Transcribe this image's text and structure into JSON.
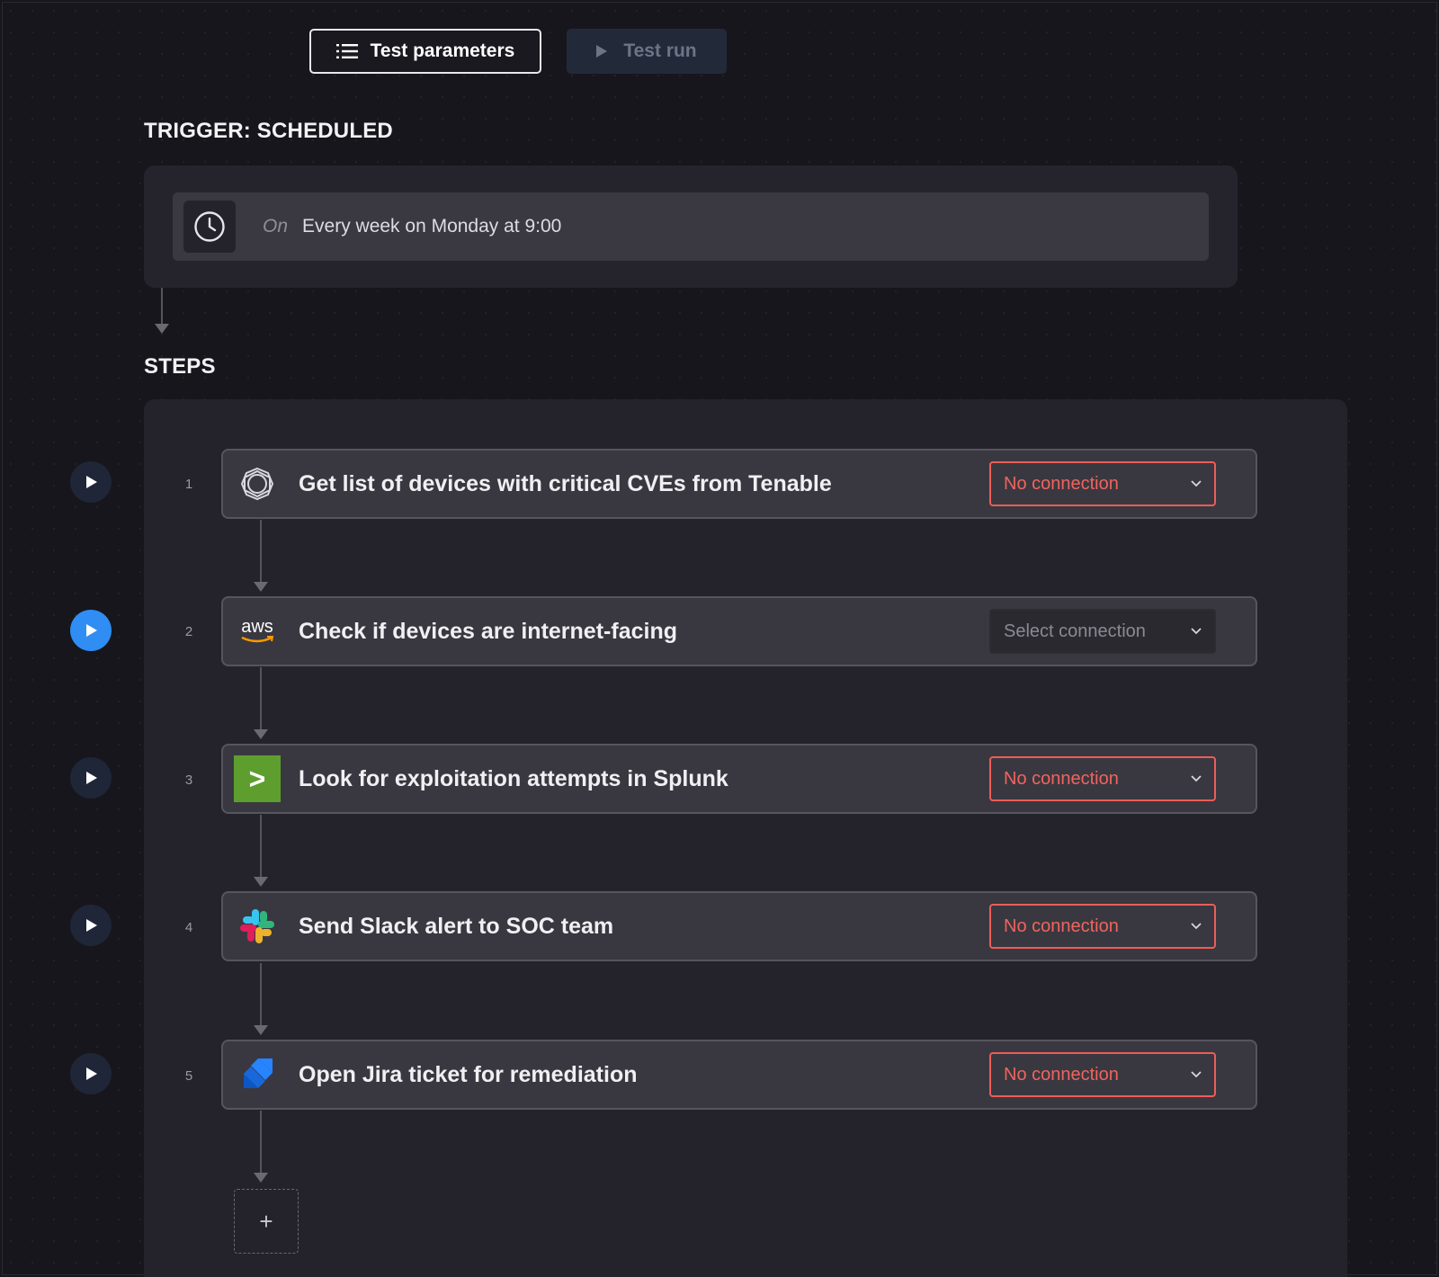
{
  "toolbar": {
    "test_parameters_label": "Test parameters",
    "test_run_label": "Test run"
  },
  "trigger": {
    "heading": "TRIGGER: SCHEDULED",
    "on_label": "On",
    "schedule": "Every week on Monday at 9:00",
    "icon": "clock-icon"
  },
  "steps": {
    "heading": "STEPS",
    "items": [
      {
        "number": "1",
        "title": "Get list of devices with critical CVEs from Tenable",
        "icon": "tenable-icon",
        "connection": "No connection",
        "connection_state": "error"
      },
      {
        "number": "2",
        "title": "Check if devices are internet-facing",
        "icon": "aws-icon",
        "icon_text": "aws",
        "connection": "Select connection",
        "connection_state": "select"
      },
      {
        "number": "3",
        "title": "Look for exploitation attempts in Splunk",
        "icon": "splunk-icon",
        "icon_text": ">",
        "connection": "No connection",
        "connection_state": "error"
      },
      {
        "number": "4",
        "title": "Send Slack alert to SOC team",
        "icon": "slack-icon",
        "connection": "No connection",
        "connection_state": "error"
      },
      {
        "number": "5",
        "title": "Open Jira ticket for remediation",
        "icon": "jira-icon",
        "connection": "No connection",
        "connection_state": "error"
      }
    ],
    "add_step_label": "+"
  },
  "colors": {
    "background": "#17161d",
    "error": "#ee5c57",
    "active_play": "#2f8df4",
    "splunk_green": "#5e9e2f"
  }
}
